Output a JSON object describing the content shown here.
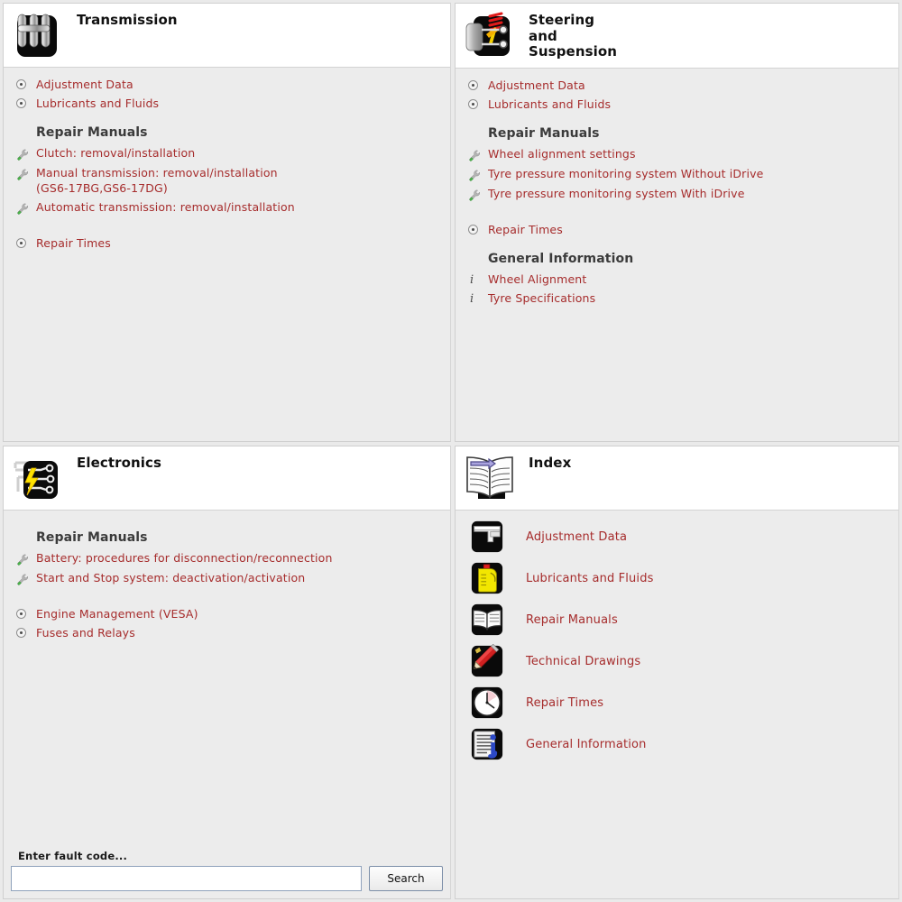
{
  "panels": {
    "transmission": {
      "title": "Transmission",
      "icon": "transmission-gear-icon",
      "links_top": [
        {
          "label": "Adjustment Data",
          "icon": "dot-bullet-icon"
        },
        {
          "label": "Lubricants and Fluids",
          "icon": "dot-bullet-icon"
        }
      ],
      "repair_manuals_heading": "Repair Manuals",
      "repair_manuals": [
        {
          "label": "Clutch: removal/installation",
          "icon": "wrench-icon"
        },
        {
          "label": "Manual transmission: removal/installation\n(GS6-17BG,GS6-17DG)",
          "icon": "wrench-icon"
        },
        {
          "label": "Automatic transmission: removal/installation",
          "icon": "wrench-icon"
        }
      ],
      "repair_times": {
        "label": "Repair Times",
        "icon": "dot-bullet-icon"
      }
    },
    "steering": {
      "title": "Steering\nand\nSuspension",
      "icon": "suspension-strut-icon",
      "links_top": [
        {
          "label": "Adjustment Data",
          "icon": "dot-bullet-icon"
        },
        {
          "label": "Lubricants and Fluids",
          "icon": "dot-bullet-icon"
        }
      ],
      "repair_manuals_heading": "Repair Manuals",
      "repair_manuals": [
        {
          "label": "Wheel alignment settings",
          "icon": "wrench-icon"
        },
        {
          "label": "Tyre pressure monitoring system Without iDrive",
          "icon": "wrench-icon"
        },
        {
          "label": "Tyre pressure monitoring system With iDrive",
          "icon": "wrench-icon"
        }
      ],
      "repair_times": {
        "label": "Repair Times",
        "icon": "dot-bullet-icon"
      },
      "general_information_heading": "General Information",
      "general_information": [
        {
          "label": "Wheel Alignment",
          "icon": "info-i-icon"
        },
        {
          "label": "Tyre Specifications",
          "icon": "info-i-icon"
        }
      ]
    },
    "electronics": {
      "title": "Electronics",
      "icon": "electronics-circuit-icon",
      "repair_manuals_heading": "Repair Manuals",
      "repair_manuals": [
        {
          "label": "Battery: procedures for disconnection/reconnection",
          "icon": "wrench-icon"
        },
        {
          "label": "Start and Stop system: deactivation/activation",
          "icon": "wrench-icon"
        }
      ],
      "links_bottom": [
        {
          "label": "Engine Management (VESA)",
          "icon": "dot-bullet-icon"
        },
        {
          "label": "Fuses and Relays",
          "icon": "dot-bullet-icon"
        }
      ],
      "search": {
        "label": "Enter fault code...",
        "value": "",
        "placeholder": "",
        "button_label": "Search"
      }
    },
    "index": {
      "title": "Index",
      "icon": "open-book-index-icon",
      "items": [
        {
          "label": "Adjustment Data",
          "icon": "caliper-icon"
        },
        {
          "label": "Lubricants and Fluids",
          "icon": "oil-can-icon"
        },
        {
          "label": "Repair Manuals",
          "icon": "open-book-icon"
        },
        {
          "label": "Technical Drawings",
          "icon": "pencil-icon"
        },
        {
          "label": "Repair Times",
          "icon": "clock-icon"
        },
        {
          "label": "General Information",
          "icon": "document-info-icon"
        }
      ]
    }
  },
  "colors": {
    "link": "#a62c2c",
    "heading": "#3b3b3b",
    "panel_background": "#ececec",
    "header_background": "#ffffff",
    "page_background": "#eaeaea",
    "border": "#cfcfcf"
  }
}
